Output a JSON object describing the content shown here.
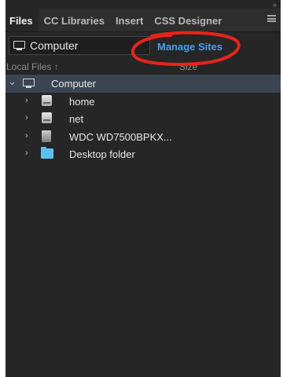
{
  "panel": {
    "collapse_glyph": "»",
    "tabs": [
      {
        "label": "Files"
      },
      {
        "label": "CC Libraries"
      },
      {
        "label": "Insert"
      },
      {
        "label": "CSS Designer"
      }
    ]
  },
  "site_bar": {
    "selected_site": "Computer",
    "manage_sites_label": "Manage Sites"
  },
  "columns": {
    "local_files": "Local Files",
    "sort_glyph": "↑",
    "size": "Size"
  },
  "tree": {
    "root": {
      "label": "Computer",
      "chevron": "⌄"
    },
    "items": [
      {
        "label": "home",
        "chevron": "›",
        "icon": "hard-drive-icon"
      },
      {
        "label": "net",
        "chevron": "›",
        "icon": "hard-drive-icon"
      },
      {
        "label": "WDC WD7500BPKX...",
        "chevron": "›",
        "icon": "external-drive-icon"
      },
      {
        "label": "Desktop folder",
        "chevron": "›",
        "icon": "folder-icon"
      }
    ]
  },
  "colors": {
    "panel_bg": "#262626",
    "link_blue": "#4a9fe8",
    "annotation_red": "#e8231c",
    "selected_row": "#3a4552",
    "folder_blue": "#5cc0f0"
  }
}
